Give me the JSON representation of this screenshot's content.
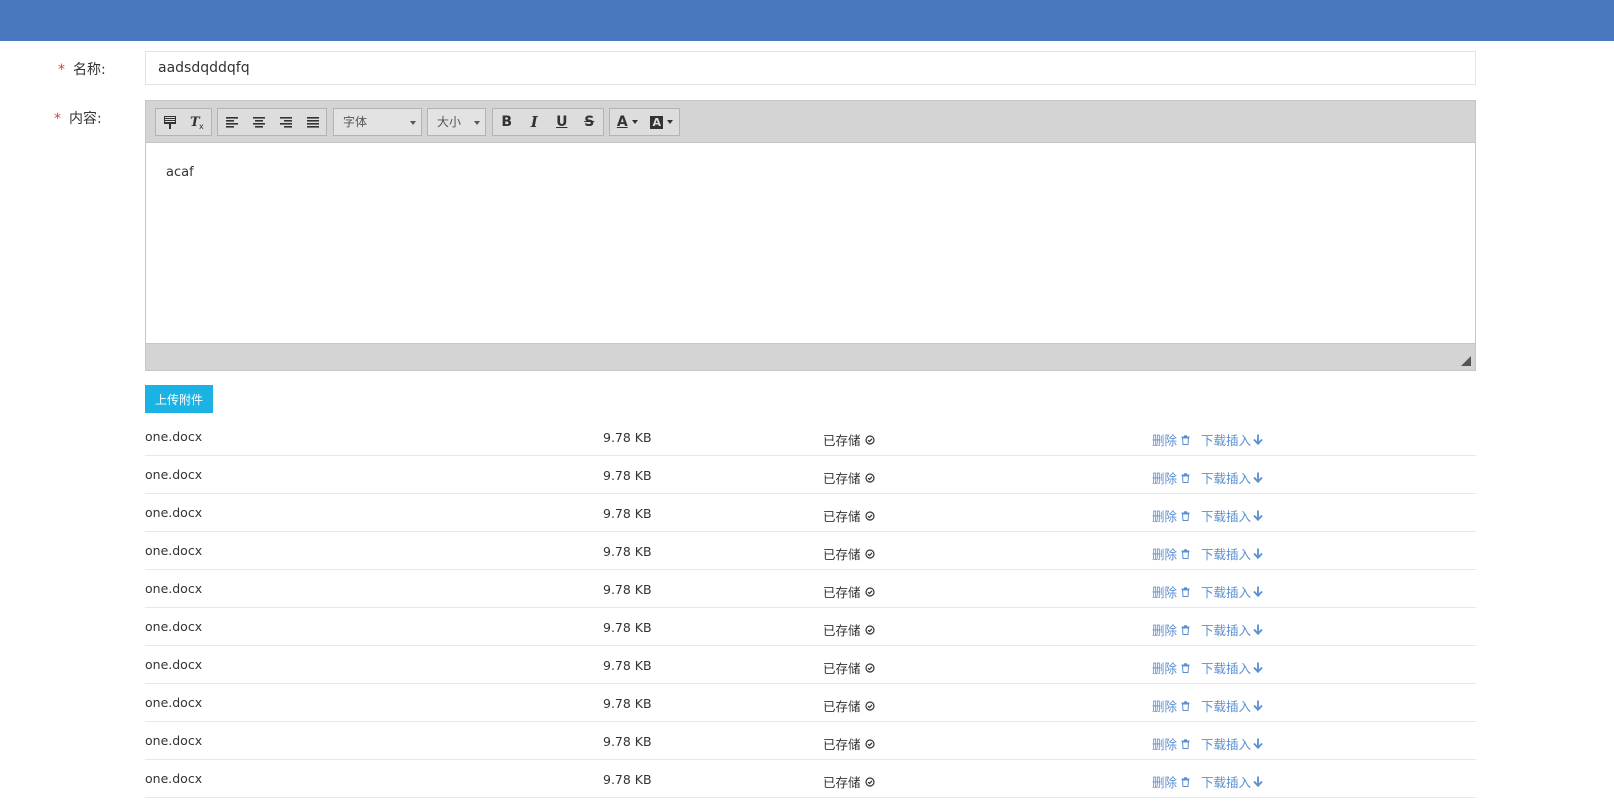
{
  "form": {
    "name_required": "*",
    "name_label": "名称:",
    "name_value": "aadsdqddqfq",
    "content_required": "*",
    "content_label": "内容:"
  },
  "editor": {
    "font_select": "字体",
    "size_select": "大小",
    "bold": "B",
    "italic": "I",
    "underline": "U",
    "strike": "S",
    "font_color": "A",
    "bg_color": "A",
    "content": "acaf"
  },
  "upload_label": "上传附件",
  "files": [
    {
      "name": "one.docx",
      "size": "9.78 KB",
      "status": "已存储",
      "delete": "删除",
      "download": "下载插入"
    },
    {
      "name": "one.docx",
      "size": "9.78 KB",
      "status": "已存储",
      "delete": "删除",
      "download": "下载插入"
    },
    {
      "name": "one.docx",
      "size": "9.78 KB",
      "status": "已存储",
      "delete": "删除",
      "download": "下载插入"
    },
    {
      "name": "one.docx",
      "size": "9.78 KB",
      "status": "已存储",
      "delete": "删除",
      "download": "下载插入"
    },
    {
      "name": "one.docx",
      "size": "9.78 KB",
      "status": "已存储",
      "delete": "删除",
      "download": "下载插入"
    },
    {
      "name": "one.docx",
      "size": "9.78 KB",
      "status": "已存储",
      "delete": "删除",
      "download": "下载插入"
    },
    {
      "name": "one.docx",
      "size": "9.78 KB",
      "status": "已存储",
      "delete": "删除",
      "download": "下载插入"
    },
    {
      "name": "one.docx",
      "size": "9.78 KB",
      "status": "已存储",
      "delete": "删除",
      "download": "下载插入"
    },
    {
      "name": "one.docx",
      "size": "9.78 KB",
      "status": "已存储",
      "delete": "删除",
      "download": "下载插入"
    },
    {
      "name": "one.docx",
      "size": "9.78 KB",
      "status": "已存储",
      "delete": "删除",
      "download": "下载插入"
    }
  ],
  "colors": {
    "header": "#4a78be",
    "required": "#e23a3a",
    "upload_button": "#1bb3e4",
    "link": "#5a8fd0"
  },
  "icons": {
    "status": "check-circle-icon",
    "delete": "trash-icon",
    "download": "arrow-down-icon"
  }
}
